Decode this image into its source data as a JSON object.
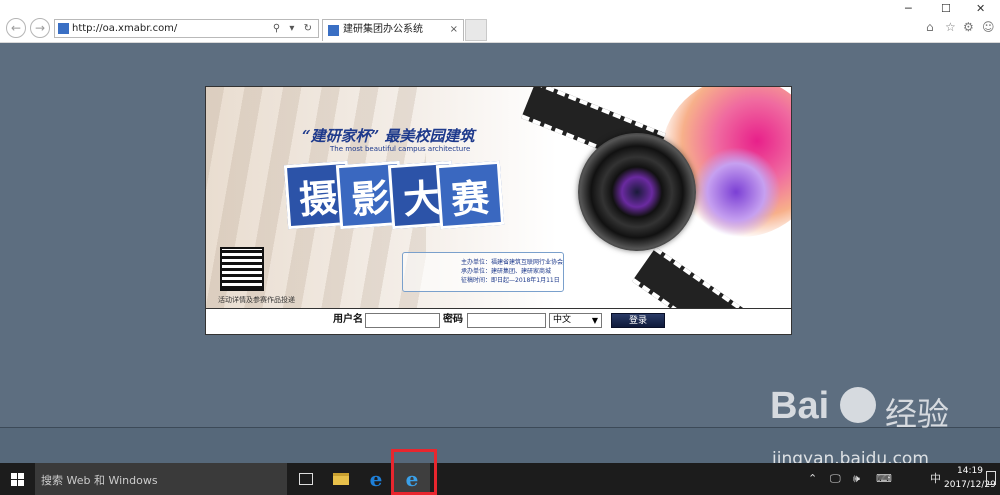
{
  "browser": {
    "url": "http://oa.xmabr.com/",
    "tab_title": "建研集团办公系统",
    "tab_close": "×",
    "addr_tools": "⚲ ▾ ↻",
    "back": "←",
    "forward": "→",
    "window_controls": {
      "minimize": "─",
      "maximize": "☐",
      "close": "✕"
    },
    "toolbar_icons": {
      "home": "⌂",
      "favorites": "☆",
      "settings": "⚙",
      "feedback": "☺"
    }
  },
  "banner": {
    "headline": "“建研家杯” 最美校园建筑",
    "subline": "The most beautiful campus architecture",
    "title_chars": [
      "摄",
      "影",
      "大",
      "赛"
    ],
    "info_lines": [
      "主办单位：福建省建筑互联网行业协会",
      "承办单位：建研集团、建研家商城",
      "征稿时间：即日起—2018年1月11日"
    ],
    "qr_caption": "活动详情及参赛作品投递"
  },
  "login": {
    "username_label": "用户名",
    "password_label": "密码",
    "language_value": "中文",
    "submit_label": "登录"
  },
  "taskbar": {
    "search_placeholder": "搜索 Web 和 Windows",
    "ime": "中",
    "time": "14:19",
    "date": "2017/12/29",
    "tray_icons": {
      "up": "⌃",
      "network": "🖵",
      "volume": "🕪",
      "keyboard": "⌨"
    }
  },
  "watermark": {
    "logo": "Bai",
    "cn": "经验",
    "url": "jingyan.baidu.com"
  },
  "colors": {
    "page_bg": "#5d6e80",
    "taskbar": "#1c1c1c",
    "highlight": "#e8262e",
    "banner_blue": "#2c53a8"
  }
}
